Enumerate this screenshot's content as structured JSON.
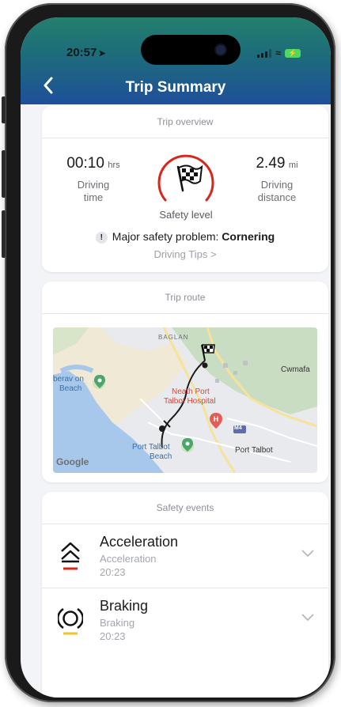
{
  "status_bar": {
    "time": "20:57"
  },
  "header": {
    "title": "Trip Summary"
  },
  "overview": {
    "header": "Trip overview",
    "driving_time_value": "00:10",
    "driving_time_unit": "hrs",
    "driving_time_label_line1": "Driving",
    "driving_time_label_line2": "time",
    "distance_value": "2.49",
    "distance_unit": "mi",
    "distance_label_line1": "Driving",
    "distance_label_line2": "distance",
    "safety_label": "Safety level",
    "problem_prefix": "Major safety problem:",
    "problem_value": "Cornering",
    "tips_link": "Driving Tips >"
  },
  "route": {
    "header": "Trip route",
    "map_labels": {
      "baglan": "BAGLAN",
      "cwmafan": "Cwmafa",
      "aberavon": "berav on",
      "aberavon2": "Beach",
      "hospital1": "Neath Port",
      "hospital2": "Talbot Hospital",
      "m4": "M4",
      "pt_beach1": "Port Talbot",
      "pt_beach2": "Beach",
      "port_talbot": "Port Talbot",
      "google": "Google"
    }
  },
  "events": {
    "header": "Safety events",
    "items": [
      {
        "title": "Acceleration",
        "type": "Acceleration",
        "time": "20:23",
        "color": "#d9261c"
      },
      {
        "title": "Braking",
        "type": "Braking",
        "time": "20:23",
        "color": "#f2c12e"
      }
    ]
  },
  "colors": {
    "header_top": "#237f6c",
    "header_bottom": "#1f4f9a",
    "gauge": "#d9261c",
    "acceleration": "#d9261c",
    "braking": "#f2c12e"
  },
  "icons": {
    "back": "chevron-left-icon",
    "gauge_center": "checkered-flag-icon",
    "warning": "exclamation-icon",
    "acceleration": "double-chevron-up-icon",
    "braking": "brake-disc-icon",
    "expand": "chevron-down-icon"
  }
}
